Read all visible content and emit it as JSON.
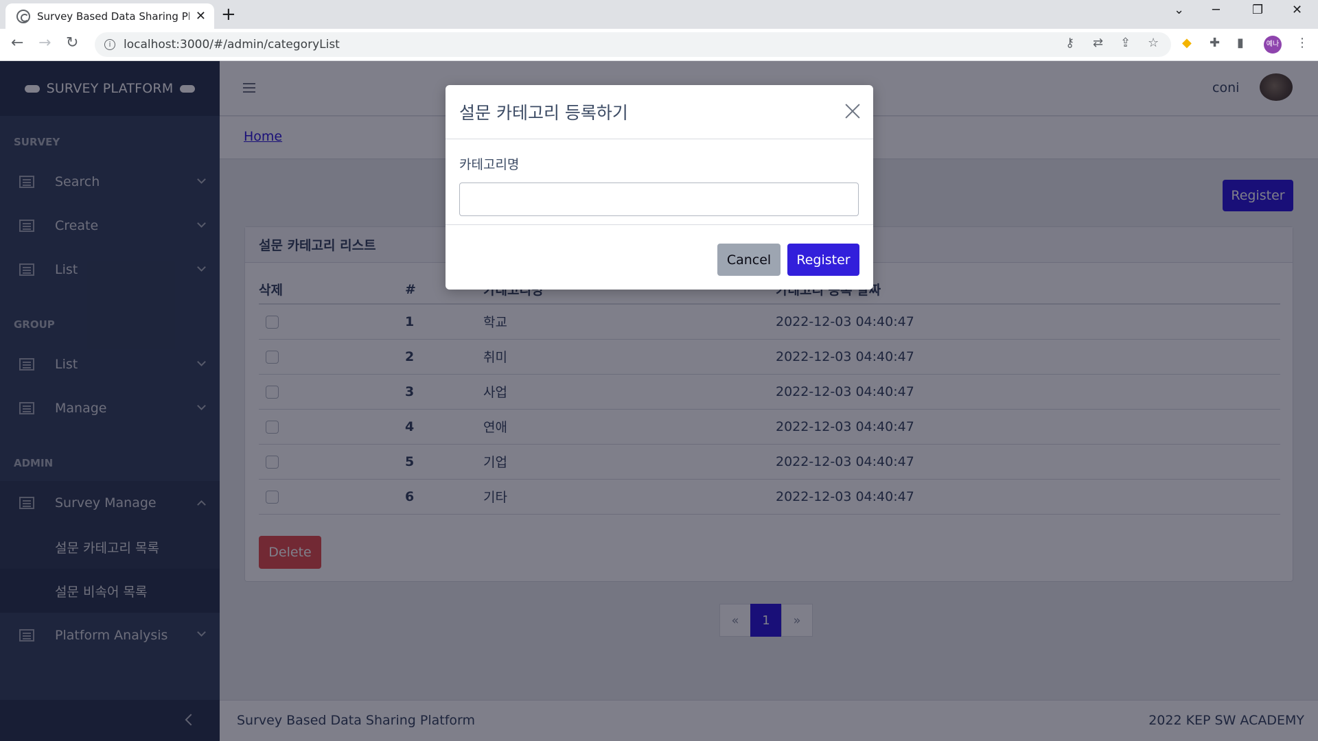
{
  "browser": {
    "tab_title": "Survey Based Data Sharing Platform",
    "url": "localhost:3000/#/admin/categoryList",
    "profile_label": "예나"
  },
  "sidebar": {
    "brand": "SURVEY PLATFORM",
    "sections": {
      "survey_title": "SURVEY",
      "survey_items": [
        "Search",
        "Create",
        "List"
      ],
      "group_title": "GROUP",
      "group_items": [
        "List",
        "Manage"
      ],
      "admin_title": "ADMIN",
      "admin_open_item": "Survey Manage",
      "admin_sub_items": [
        "설문 카테고리 목록",
        "설문 비속어 목록"
      ],
      "admin_last_item": "Platform Analysis"
    }
  },
  "header": {
    "username": "coni",
    "breadcrumb": "Home"
  },
  "main": {
    "register_button": "Register",
    "card_title": "설문 카테고리 리스트",
    "columns": [
      "삭제",
      "#",
      "카테고리명",
      "카테고리 등록 날짜"
    ],
    "rows": [
      {
        "num": "1",
        "name": "학교",
        "date": "2022-12-03 04:40:47"
      },
      {
        "num": "2",
        "name": "취미",
        "date": "2022-12-03 04:40:47"
      },
      {
        "num": "3",
        "name": "사업",
        "date": "2022-12-03 04:40:47"
      },
      {
        "num": "4",
        "name": "연애",
        "date": "2022-12-03 04:40:47"
      },
      {
        "num": "5",
        "name": "기업",
        "date": "2022-12-03 04:40:47"
      },
      {
        "num": "6",
        "name": "기타",
        "date": "2022-12-03 04:40:47"
      }
    ],
    "delete_button": "Delete",
    "pagination": {
      "prev": "«",
      "current": "1",
      "next": "»"
    }
  },
  "footer": {
    "left": "Survey Based Data Sharing Platform",
    "right": "2022 KEP SW ACADEMY"
  },
  "modal": {
    "title": "설문 카테고리 등록하기",
    "field_label": "카테고리명",
    "field_value": "",
    "cancel_button": "Cancel",
    "register_button": "Register"
  },
  "colors": {
    "primary": "#321fdb",
    "danger": "#e55353",
    "sidebar": "#3c4b64",
    "secondary": "#9da5b1"
  }
}
